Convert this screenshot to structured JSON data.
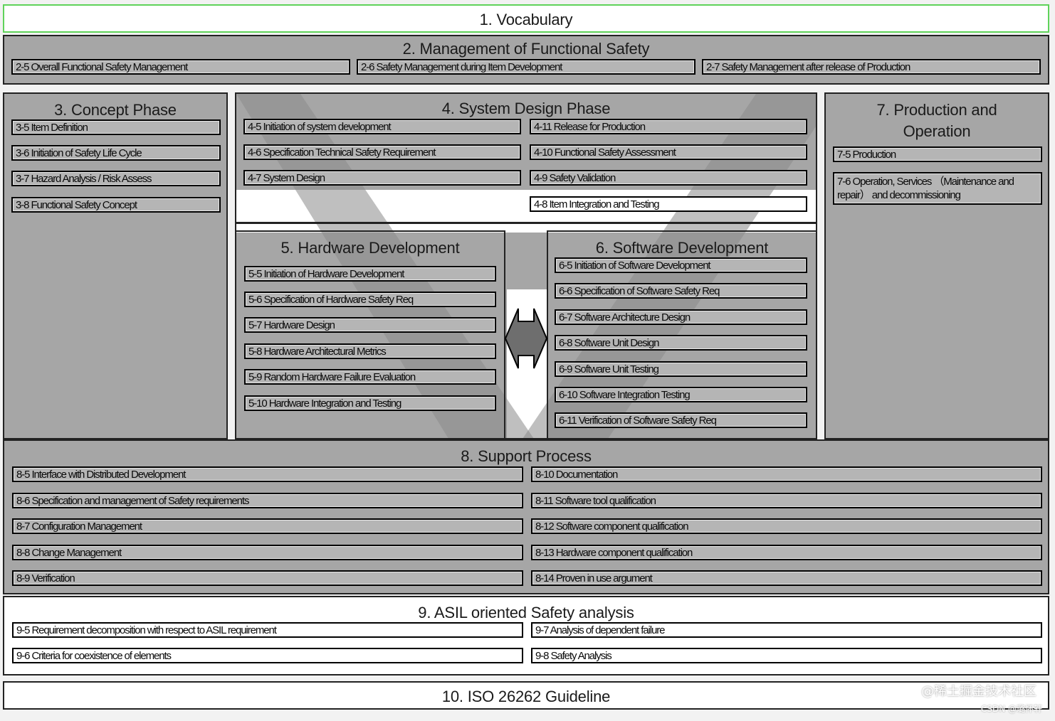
{
  "vocabulary": {
    "title": "1. Vocabulary"
  },
  "management": {
    "title": "2. Management of Functional Safety",
    "items": [
      "2-5 Overall Functional Safety Management",
      "2-6 Safety Management during Item Development",
      "2-7 Safety Management after release of Production"
    ]
  },
  "concept": {
    "title": "3. Concept Phase",
    "items": [
      "3-5 Item Definition",
      "3-6 Initiation of Safety Life Cycle",
      "3-7 Hazard Analysis / Risk Assess",
      "3-8 Functional Safety Concept"
    ]
  },
  "system": {
    "title": "4. System Design Phase",
    "left_items": [
      "4-5 Initiation of system development",
      "4-6 Specification Technical Safety Requirement",
      "4-7 System Design"
    ],
    "right_items": [
      "4-11 Release for Production",
      "4-10 Functional Safety Assessment",
      "4-9 Safety Validation",
      "4-8 Item Integration and Testing"
    ]
  },
  "hardware": {
    "title": "5. Hardware Development",
    "items": [
      "5-5 Initiation of Hardware Development",
      "5-6 Specification of Hardware Safety Req",
      "5-7 Hardware Design",
      "5-8 Hardware Architectural Metrics",
      "5-9 Random Hardware Failure Evaluation",
      "5-10 Hardware Integration and Testing"
    ]
  },
  "software": {
    "title": "6. Software Development",
    "items": [
      "6-5 Initiation of Software Development",
      "6-6 Specification of Software Safety Req",
      "6-7 Software Architecture Design",
      "6-8 Software Unit Design",
      "6-9 Software Unit Testing",
      "6-10 Software Integration Testing",
      "6-11 Verification of Software Safety Req"
    ]
  },
  "production": {
    "title_line1": "7. Production and",
    "title_line2": "Operation",
    "items": [
      "7-5 Production",
      "7-6 Operation, Services （Maintenance and repair） and decommissioning"
    ]
  },
  "support": {
    "title": "8. Support Process",
    "left_items": [
      "8-5 Interface with Distributed Development",
      "8-6 Specification and management of Safety requirements",
      "8-7 Configuration Management",
      "8-8 Change Management",
      "8-9 Verification"
    ],
    "right_items": [
      "8-10 Documentation",
      "8-11 Software tool qualification",
      "8-12 Software component qualification",
      "8-13 Hardware component qualification",
      "8-14 Proven in use argument"
    ]
  },
  "asil": {
    "title": "9. ASIL oriented Safety analysis",
    "left_items": [
      "9-5 Requirement decomposition with respect to ASIL requirement",
      "9-6 Criteria for coexistence of elements"
    ],
    "right_items": [
      "9-7 Analysis of dependent failure",
      "9-8 Safety Analysis"
    ]
  },
  "guideline": {
    "title": "10. ISO 26262 Guideline"
  },
  "watermark": {
    "line1": "@稀土掘金技术社区",
    "line2": "CSDN @璐怀轩"
  }
}
